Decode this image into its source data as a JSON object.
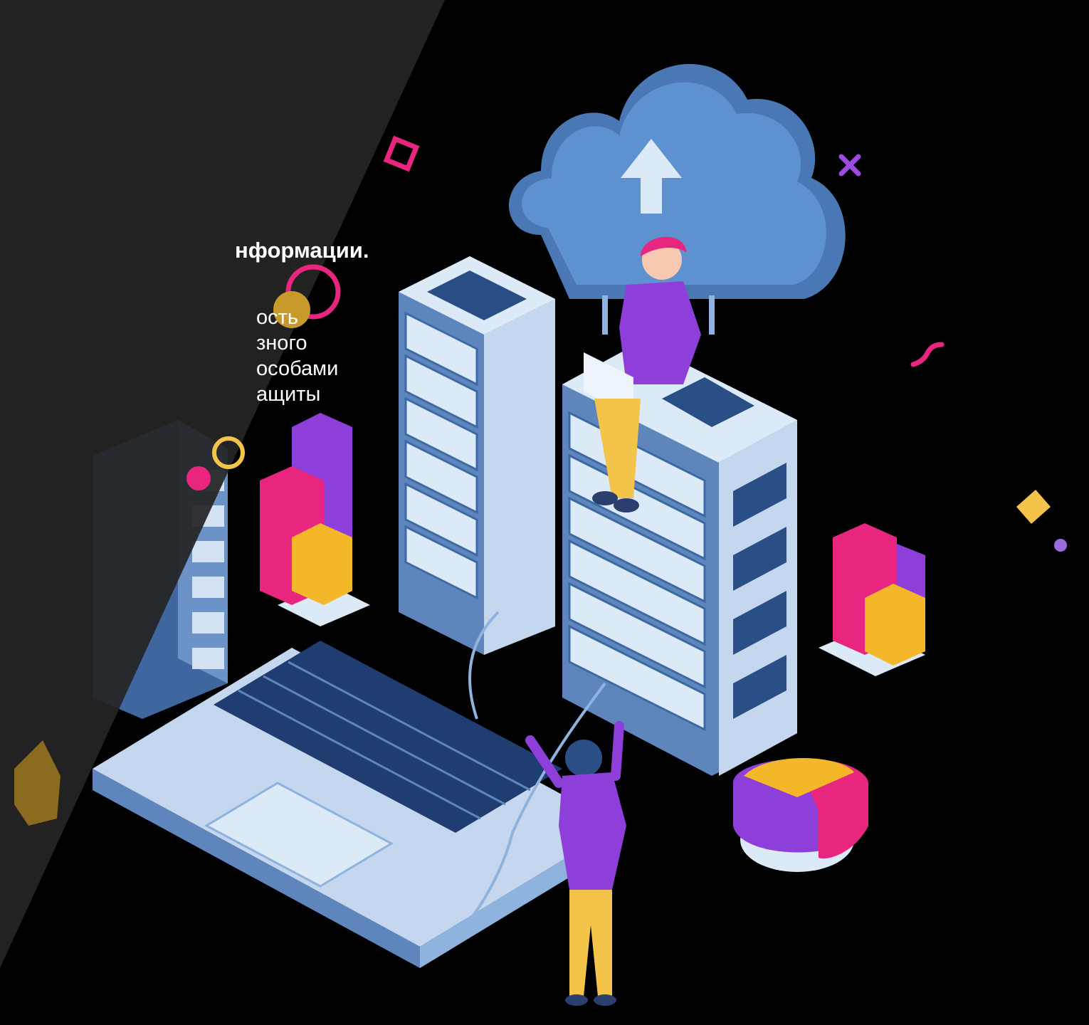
{
  "slide": {
    "heading": "нформации.",
    "body_lines": [
      "ость",
      "зного",
      "особами",
      "ащиты"
    ]
  },
  "colors": {
    "background": "#000000",
    "panel": "#252525",
    "server": "#dce9f6",
    "server_slot": "#4a78b4",
    "cloud": "#5e91cf",
    "accent_pink": "#e8267f",
    "accent_purple": "#8f3fd9",
    "accent_yellow": "#f4b72a"
  },
  "illustration": {
    "subject": "isometric data center",
    "icons": [
      "cloud-upload-icon",
      "server-rack",
      "laptop",
      "pie-chart-3d",
      "bar-chart-3d"
    ]
  }
}
